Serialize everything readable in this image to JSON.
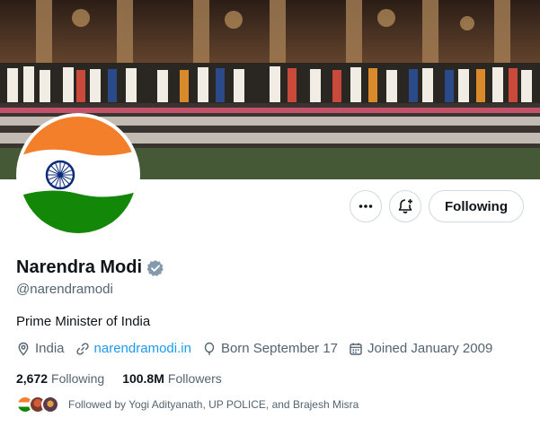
{
  "profile": {
    "name": "Narendra Modi",
    "handle": "@narendramodi",
    "bio": "Prime Minister of India",
    "location": "India",
    "website": "narendramodi.in",
    "born": "Born September 17",
    "joined": "Joined January 2009",
    "following_count": "2,672",
    "following_label": "Following",
    "followers_count": "100.8M",
    "followers_label": "Followers",
    "followed_by": "Followed by Yogi Adityanath, UP POLICE, and Brajesh Misra",
    "verified_color": "#829aab"
  },
  "actions": {
    "follow_label": "Following",
    "more_icon": "more-horizontal-icon",
    "notify_icon": "bell-plus-icon"
  },
  "colors": {
    "link": "#1d9bf0",
    "secondary_text": "#536471",
    "flag_saffron": "#f47f2a",
    "flag_green": "#138808",
    "chakra": "#0a2a7a"
  }
}
